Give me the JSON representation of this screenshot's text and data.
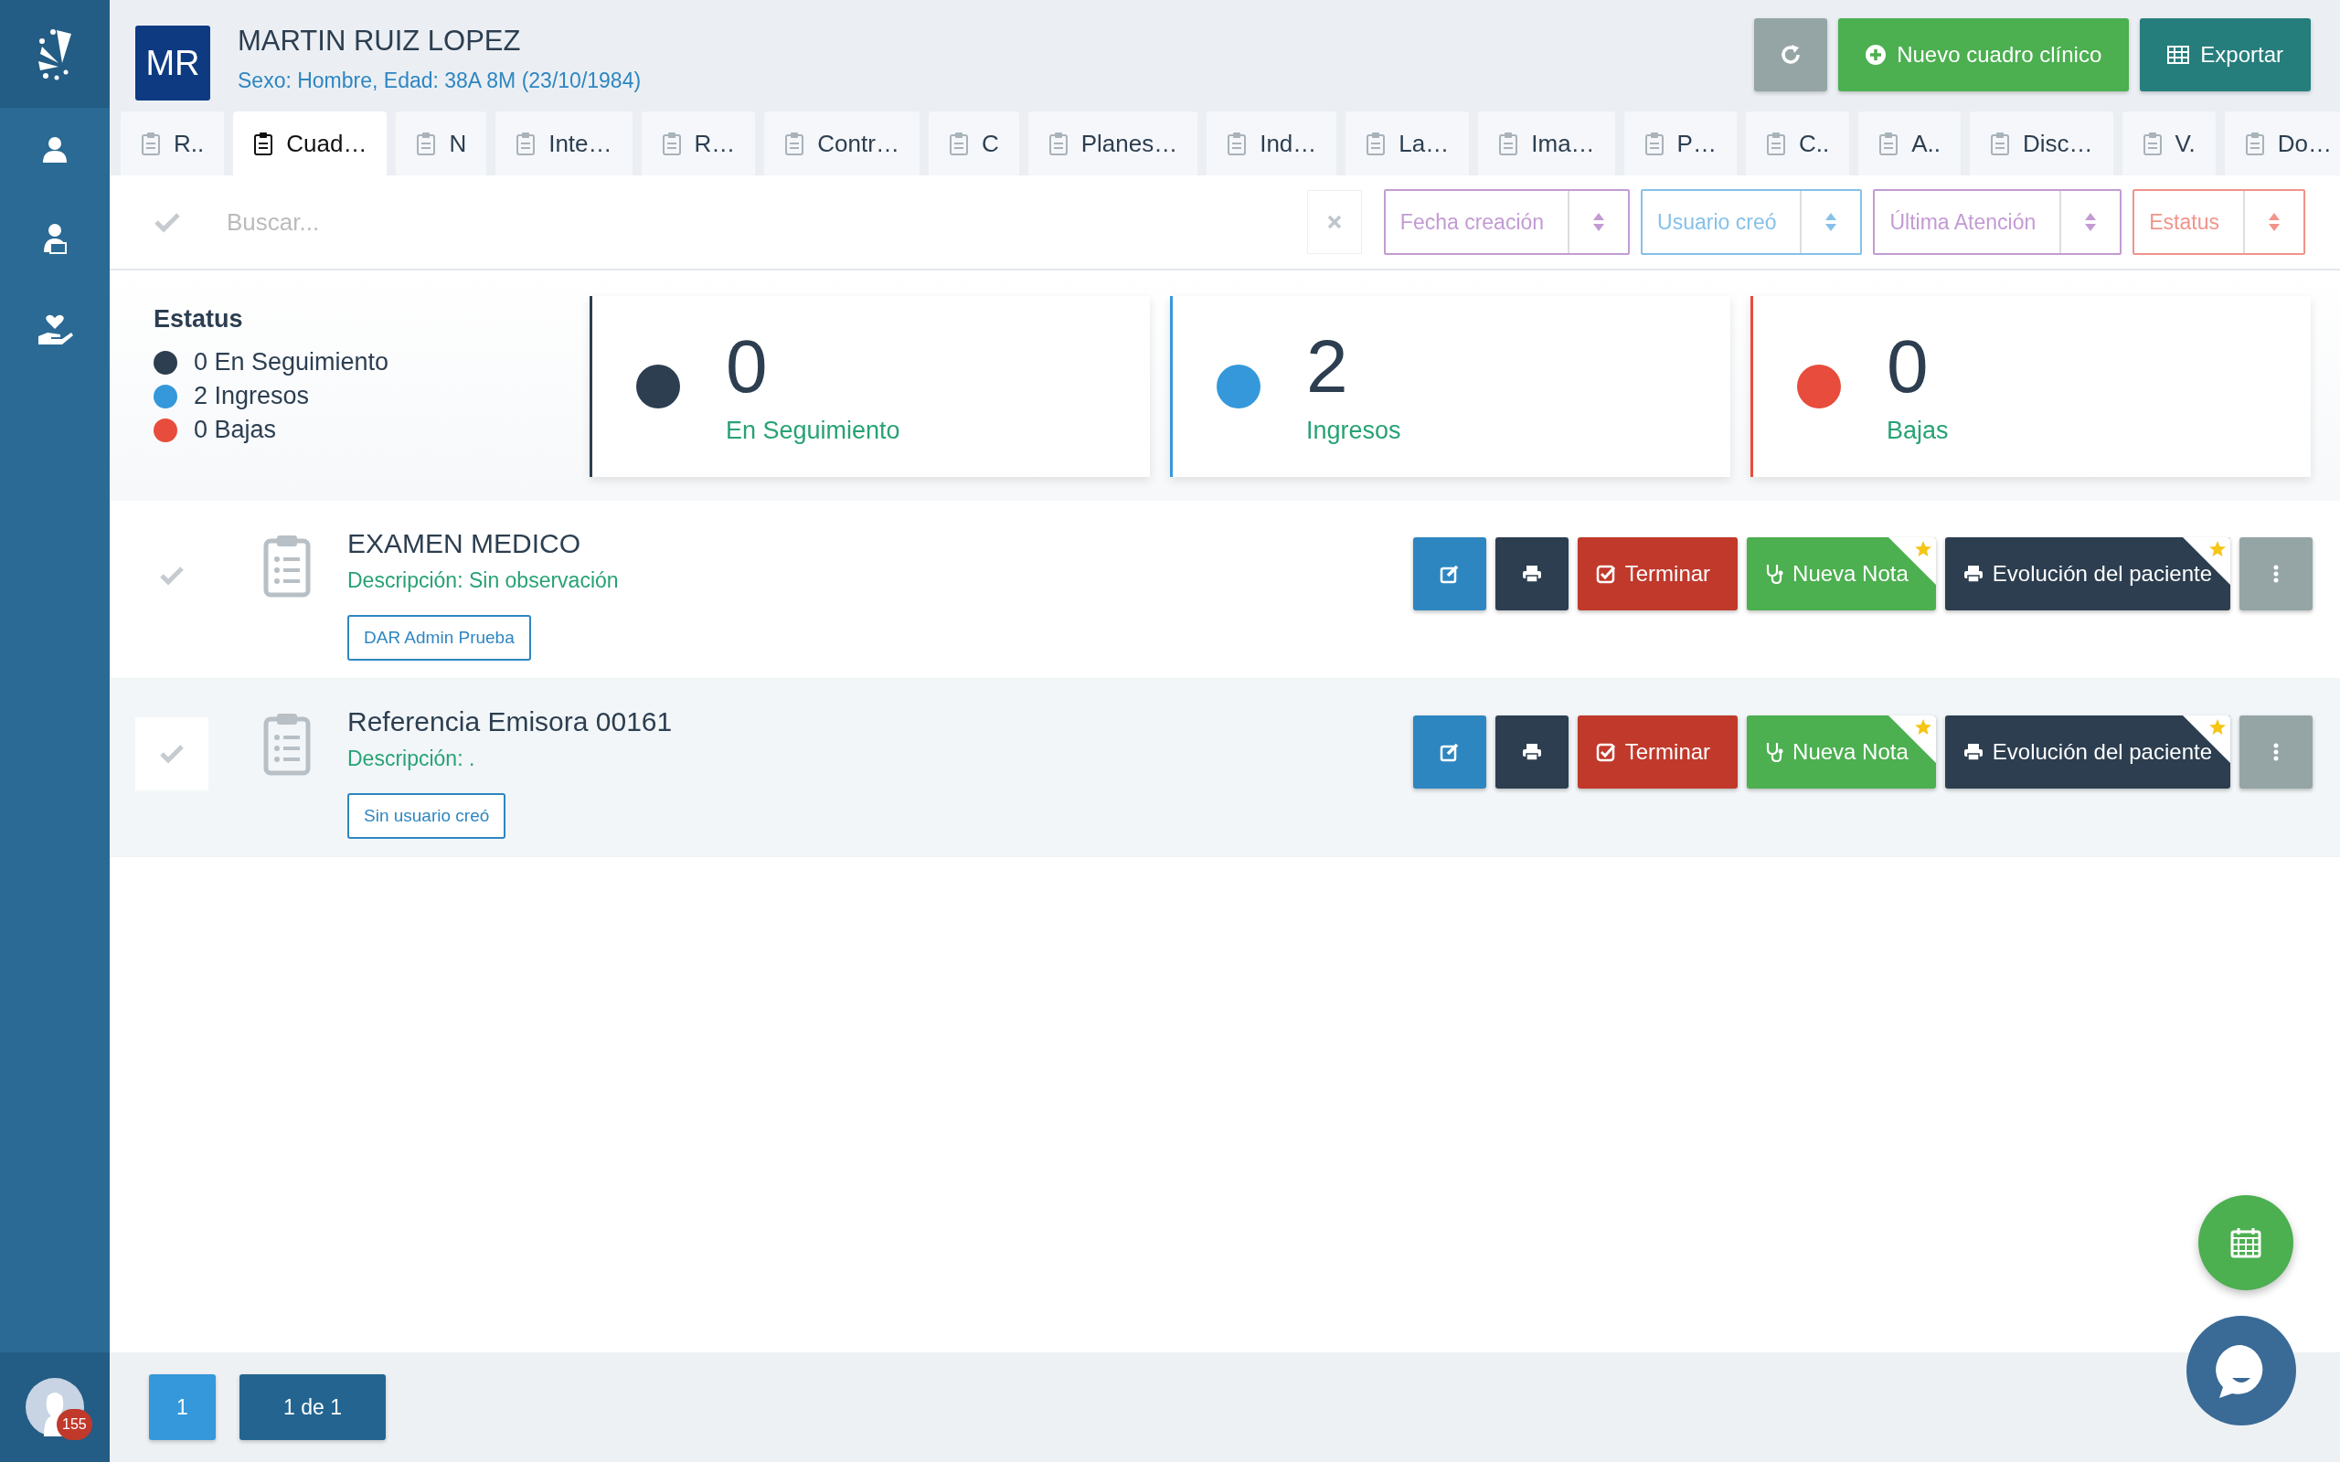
{
  "patient": {
    "initials": "MR",
    "name": "MARTIN RUIZ LOPEZ",
    "details": "Sexo: Hombre, Edad: 38A 8M (23/10/1984)"
  },
  "header_buttons": [
    {
      "kind": "refresh"
    },
    {
      "kind": "new",
      "label": "Nuevo cuadro clínico"
    },
    {
      "kind": "export",
      "label": "Exportar"
    }
  ],
  "tabs": [
    {
      "label": "R..",
      "selected": false
    },
    {
      "label": "Cuad…",
      "selected": true
    },
    {
      "label": "N",
      "selected": false
    },
    {
      "label": "Inte…",
      "selected": false
    },
    {
      "label": "R…",
      "selected": false
    },
    {
      "label": "Contr…",
      "selected": false
    },
    {
      "label": "C",
      "selected": false
    },
    {
      "label": "Planes…",
      "selected": false
    },
    {
      "label": "Ind…",
      "selected": false
    },
    {
      "label": "La…",
      "selected": false
    },
    {
      "label": "Ima…",
      "selected": false
    },
    {
      "label": "P…",
      "selected": false
    },
    {
      "label": "C..",
      "selected": false
    },
    {
      "label": "A..",
      "selected": false
    },
    {
      "label": "Disc…",
      "selected": false
    },
    {
      "label": "V.",
      "selected": false
    },
    {
      "label": "Do…",
      "selected": false
    }
  ],
  "search": {
    "placeholder": "Buscar..."
  },
  "filters": [
    {
      "placeholder": "Fecha creación",
      "color": "#c39bd3"
    },
    {
      "placeholder": "Usuario creó",
      "color": "#85c1e9"
    },
    {
      "placeholder": "Última Atención",
      "color": "#c39bd3"
    },
    {
      "placeholder": "Estatus",
      "color": "#f1948a"
    }
  ],
  "status_legend": {
    "title": "Estatus",
    "items": [
      {
        "label": "0 En Seguimiento",
        "color": "#2c3e50"
      },
      {
        "label": "2 Ingresos",
        "color": "#3498db"
      },
      {
        "label": "0 Bajas",
        "color": "#e74c3c"
      }
    ]
  },
  "status_cards": [
    {
      "count": "0",
      "label": "En Seguimiento",
      "color": "#2c3e50"
    },
    {
      "count": "2",
      "label": "Ingresos",
      "color": "#3498db"
    },
    {
      "count": "0",
      "label": "Bajas",
      "color": "#e74c3c"
    }
  ],
  "records": [
    {
      "title": "EXAMEN MEDICO",
      "description": "Descripción: Sin observación",
      "user": "DAR Admin Prueba",
      "highlighted": false,
      "actions": [
        {
          "kind": "edit"
        },
        {
          "kind": "print"
        },
        {
          "kind": "finish",
          "label": "Terminar"
        },
        {
          "kind": "note",
          "label": "Nueva Nota",
          "starred": true
        },
        {
          "kind": "evolution",
          "label": "Evolución del paciente",
          "starred": true
        },
        {
          "kind": "more"
        }
      ]
    },
    {
      "title": "Referencia Emisora 00161",
      "description": "Descripción: .",
      "user": "Sin usuario creó",
      "highlighted": true,
      "actions": [
        {
          "kind": "edit"
        },
        {
          "kind": "print"
        },
        {
          "kind": "finish",
          "label": "Terminar"
        },
        {
          "kind": "note",
          "label": "Nueva Nota",
          "starred": true
        },
        {
          "kind": "evolution",
          "label": "Evolución del paciente",
          "starred": true
        },
        {
          "kind": "more"
        }
      ]
    }
  ],
  "pagination": {
    "page": "1",
    "summary": "1 de 1"
  },
  "user": {
    "notifications": "155"
  }
}
